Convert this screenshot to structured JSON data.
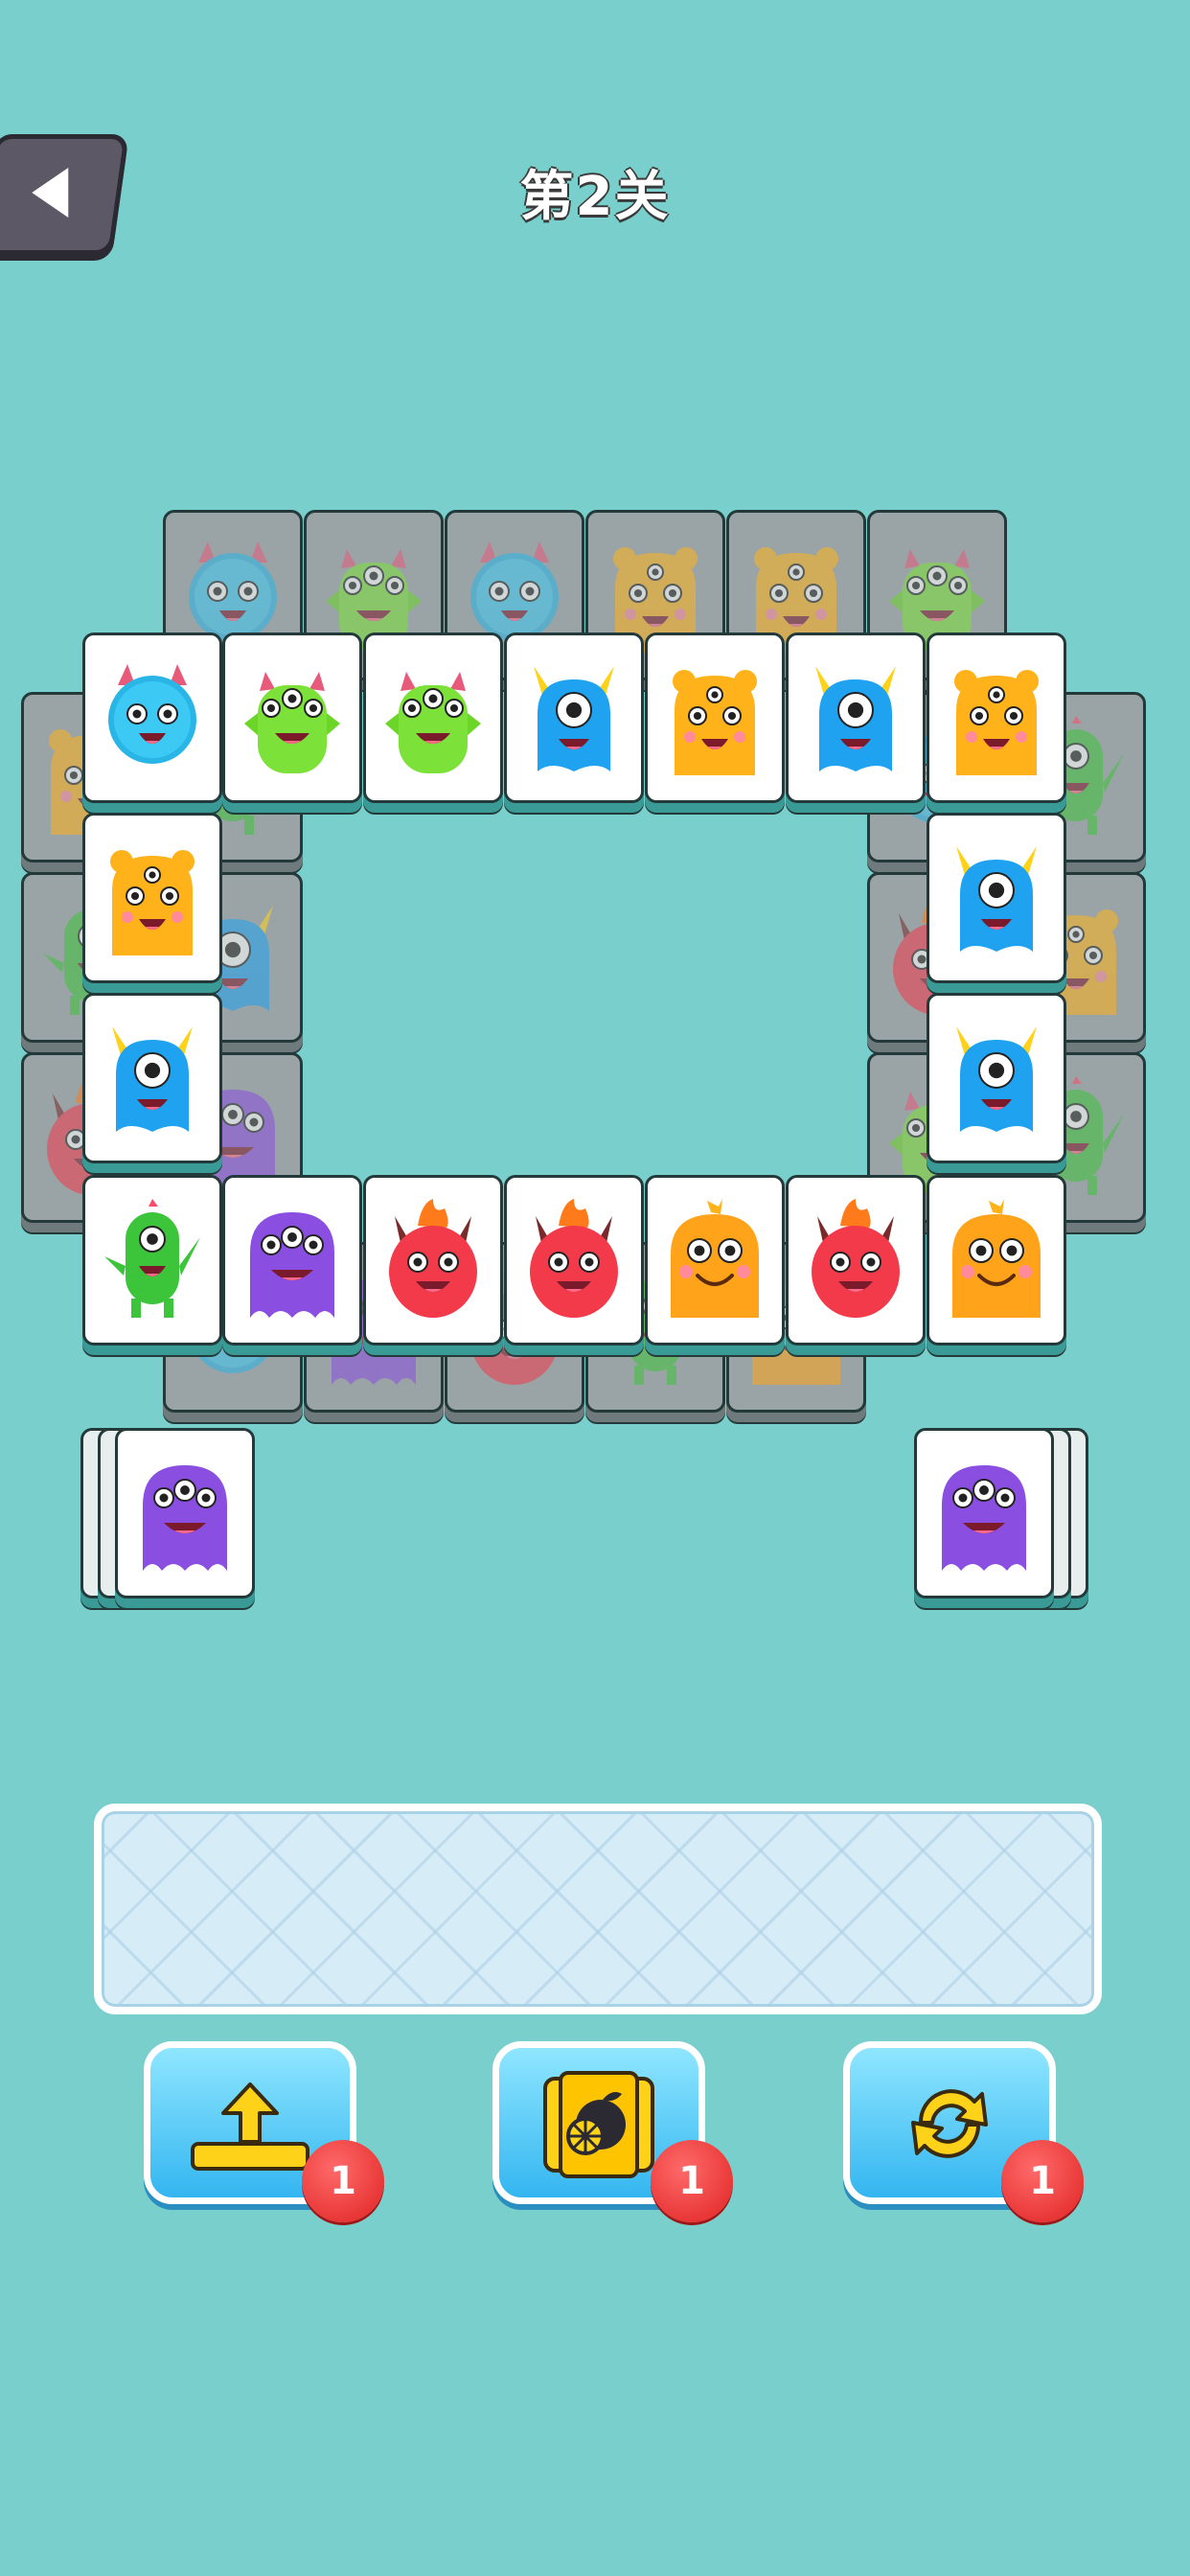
{
  "header": {
    "title": "第2关"
  },
  "colors": {
    "background": "#79cfcb",
    "tile_face": "#ffffff",
    "tile_under": "#9aa4a6",
    "badge": "#e02222"
  },
  "board": {
    "tiles": [
      {
        "monster": "blue-fuzzy",
        "layer": "under"
      },
      {
        "monster": "green-three-eyed",
        "layer": "under"
      },
      {
        "monster": "blue-fuzzy",
        "layer": "under"
      },
      {
        "monster": "orange-bear",
        "layer": "under"
      },
      {
        "monster": "orange-bear",
        "layer": "under"
      },
      {
        "monster": "green-three-eyed",
        "layer": "under"
      },
      {
        "monster": "orange-bear",
        "layer": "under"
      },
      {
        "monster": "green-cyclops",
        "layer": "under"
      },
      {
        "monster": "red-flame",
        "layer": "under"
      },
      {
        "monster": "green-cyclops",
        "layer": "under"
      },
      {
        "monster": "blue-cyclops",
        "layer": "under"
      },
      {
        "monster": "purple-ghost",
        "layer": "under"
      },
      {
        "monster": "blue-fuzzy",
        "layer": "under"
      },
      {
        "monster": "red-flame",
        "layer": "under"
      },
      {
        "monster": "green-three-eyed",
        "layer": "under"
      },
      {
        "monster": "green-cyclops",
        "layer": "under"
      },
      {
        "monster": "orange-bear",
        "layer": "under"
      },
      {
        "monster": "green-cyclops",
        "layer": "under"
      },
      {
        "monster": "blue-fuzzy",
        "layer": "under"
      },
      {
        "monster": "purple-ghost",
        "layer": "under"
      },
      {
        "monster": "red-flame",
        "layer": "under"
      },
      {
        "monster": "green-cyclops",
        "layer": "under"
      },
      {
        "monster": "orange-blob",
        "layer": "under"
      },
      {
        "monster": "blue-fuzzy",
        "layer": "top"
      },
      {
        "monster": "green-three-eyed",
        "layer": "top"
      },
      {
        "monster": "green-three-eyed",
        "layer": "top"
      },
      {
        "monster": "blue-cyclops",
        "layer": "top"
      },
      {
        "monster": "orange-bear",
        "layer": "top"
      },
      {
        "monster": "blue-cyclops",
        "layer": "top"
      },
      {
        "monster": "orange-bear",
        "layer": "top"
      },
      {
        "monster": "orange-bear",
        "layer": "top"
      },
      {
        "monster": "blue-cyclops",
        "layer": "top"
      },
      {
        "monster": "blue-cyclops",
        "layer": "top"
      },
      {
        "monster": "blue-cyclops",
        "layer": "top"
      },
      {
        "monster": "green-cyclops",
        "layer": "top"
      },
      {
        "monster": "purple-ghost",
        "layer": "top"
      },
      {
        "monster": "red-flame",
        "layer": "top"
      },
      {
        "monster": "red-flame",
        "layer": "top"
      },
      {
        "monster": "orange-blob",
        "layer": "top"
      },
      {
        "monster": "red-flame",
        "layer": "top"
      },
      {
        "monster": "orange-blob",
        "layer": "top"
      },
      {
        "monster": "purple-ghost",
        "layer": "stack-left"
      },
      {
        "monster": "purple-ghost",
        "layer": "stack-right"
      }
    ]
  },
  "tray": {
    "slots_filled": 0
  },
  "powerups": [
    {
      "name": "undo",
      "icon": "move-out-arrow-icon",
      "count": "1"
    },
    {
      "name": "hint",
      "icon": "fruit-card-icon",
      "count": "1"
    },
    {
      "name": "shuffle",
      "icon": "shuffle-icon",
      "count": "1"
    }
  ]
}
